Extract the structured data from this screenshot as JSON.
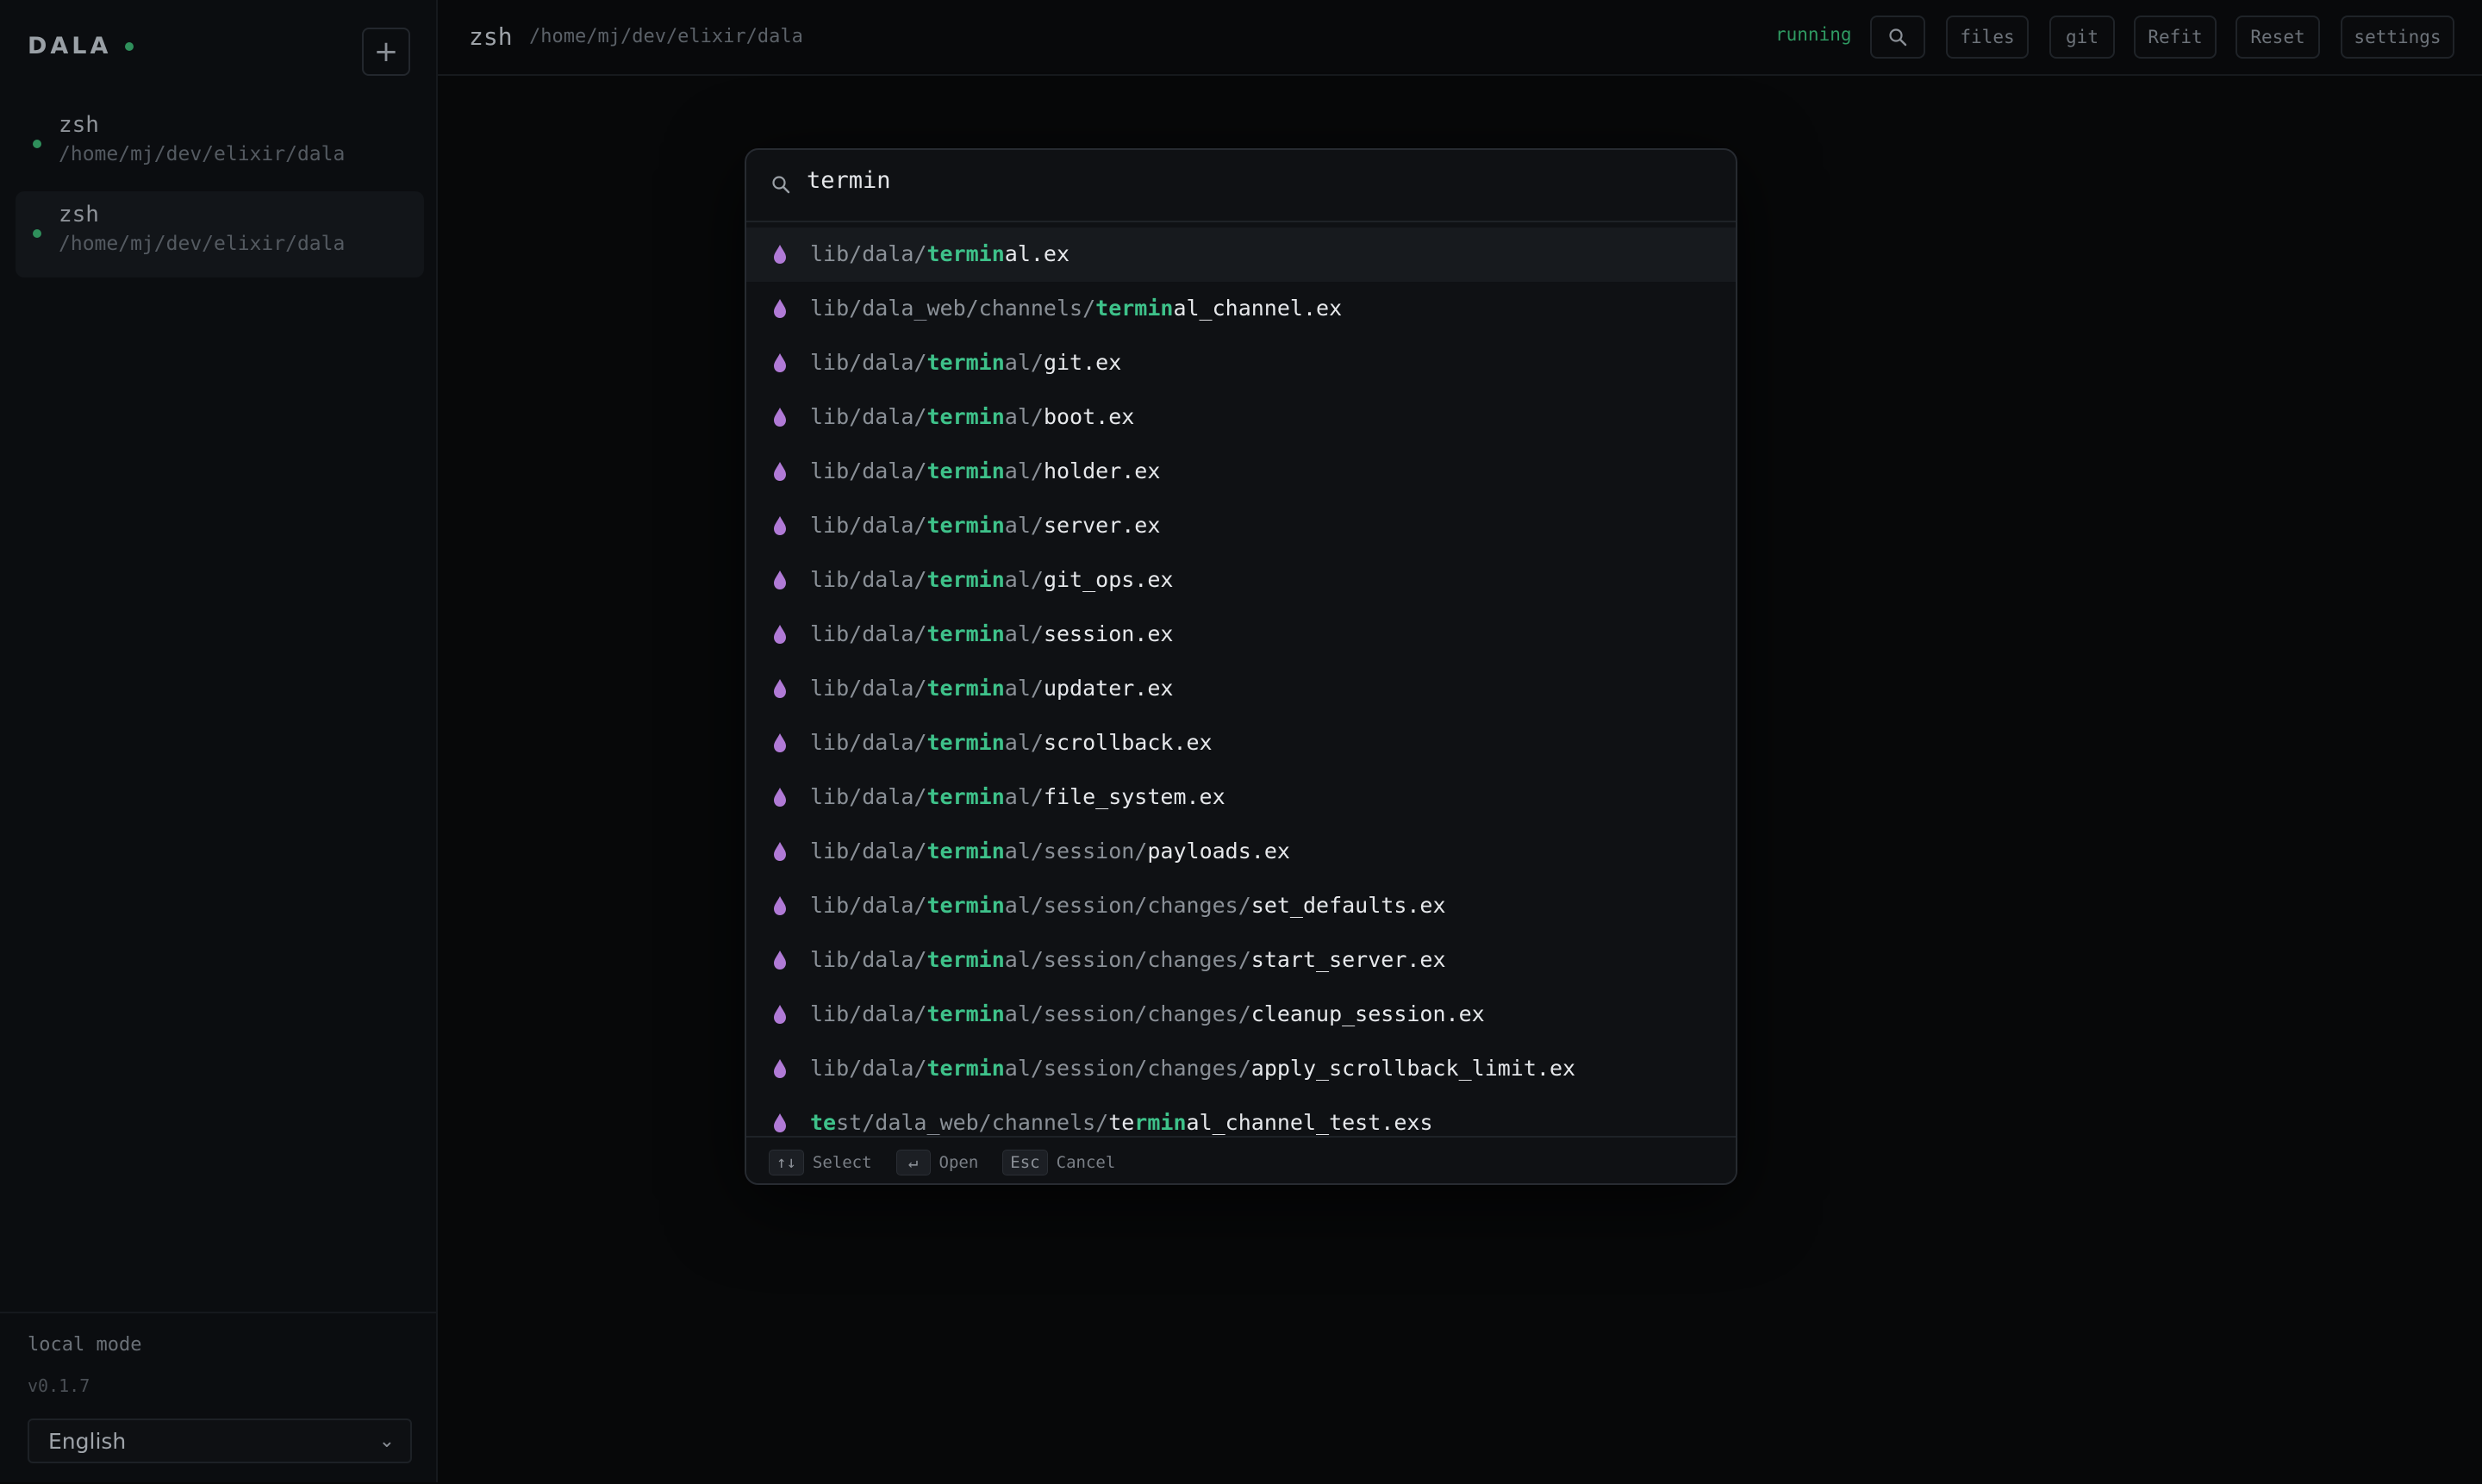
{
  "sidebar": {
    "brand": "DALA",
    "add_label": "+",
    "sessions": [
      {
        "name": "zsh",
        "path": "/home/mj/dev/elixir/dala"
      },
      {
        "name": "zsh",
        "path": "/home/mj/dev/elixir/dala"
      }
    ],
    "mode": "local mode",
    "version": "v0.1.7",
    "language": "English"
  },
  "topbar": {
    "title": "zsh",
    "path": "/home/mj/dev/elixir/dala",
    "status": "running",
    "buttons": {
      "files": "files",
      "git": "git",
      "refit": "Refit",
      "reset": "Reset",
      "settings": "settings"
    }
  },
  "palette": {
    "query": "termin",
    "results": [
      [
        [
          "dir",
          "lib/dala/"
        ],
        [
          "match",
          "termin"
        ],
        [
          "name",
          "al.ex"
        ]
      ],
      [
        [
          "dir",
          "lib/dala_web/channels/"
        ],
        [
          "match",
          "termin"
        ],
        [
          "name",
          "al_channel.ex"
        ]
      ],
      [
        [
          "dir",
          "lib/dala/"
        ],
        [
          "match",
          "termin"
        ],
        [
          "dir",
          "al/"
        ],
        [
          "name",
          "git.ex"
        ]
      ],
      [
        [
          "dir",
          "lib/dala/"
        ],
        [
          "match",
          "termin"
        ],
        [
          "dir",
          "al/"
        ],
        [
          "name",
          "boot.ex"
        ]
      ],
      [
        [
          "dir",
          "lib/dala/"
        ],
        [
          "match",
          "termin"
        ],
        [
          "dir",
          "al/"
        ],
        [
          "name",
          "holder.ex"
        ]
      ],
      [
        [
          "dir",
          "lib/dala/"
        ],
        [
          "match",
          "termin"
        ],
        [
          "dir",
          "al/"
        ],
        [
          "name",
          "server.ex"
        ]
      ],
      [
        [
          "dir",
          "lib/dala/"
        ],
        [
          "match",
          "termin"
        ],
        [
          "dir",
          "al/"
        ],
        [
          "name",
          "git_ops.ex"
        ]
      ],
      [
        [
          "dir",
          "lib/dala/"
        ],
        [
          "match",
          "termin"
        ],
        [
          "dir",
          "al/"
        ],
        [
          "name",
          "session.ex"
        ]
      ],
      [
        [
          "dir",
          "lib/dala/"
        ],
        [
          "match",
          "termin"
        ],
        [
          "dir",
          "al/"
        ],
        [
          "name",
          "updater.ex"
        ]
      ],
      [
        [
          "dir",
          "lib/dala/"
        ],
        [
          "match",
          "termin"
        ],
        [
          "dir",
          "al/"
        ],
        [
          "name",
          "scrollback.ex"
        ]
      ],
      [
        [
          "dir",
          "lib/dala/"
        ],
        [
          "match",
          "termin"
        ],
        [
          "dir",
          "al/"
        ],
        [
          "name",
          "file_system.ex"
        ]
      ],
      [
        [
          "dir",
          "lib/dala/"
        ],
        [
          "match",
          "termin"
        ],
        [
          "dir",
          "al/session/"
        ],
        [
          "name",
          "payloads.ex"
        ]
      ],
      [
        [
          "dir",
          "lib/dala/"
        ],
        [
          "match",
          "termin"
        ],
        [
          "dir",
          "al/session/changes/"
        ],
        [
          "name",
          "set_defaults.ex"
        ]
      ],
      [
        [
          "dir",
          "lib/dala/"
        ],
        [
          "match",
          "termin"
        ],
        [
          "dir",
          "al/session/changes/"
        ],
        [
          "name",
          "start_server.ex"
        ]
      ],
      [
        [
          "dir",
          "lib/dala/"
        ],
        [
          "match",
          "termin"
        ],
        [
          "dir",
          "al/session/changes/"
        ],
        [
          "name",
          "cleanup_session.ex"
        ]
      ],
      [
        [
          "dir",
          "lib/dala/"
        ],
        [
          "match",
          "termin"
        ],
        [
          "dir",
          "al/session/changes/"
        ],
        [
          "name",
          "apply_scrollback_limit.ex"
        ]
      ],
      [
        [
          "match",
          "te"
        ],
        [
          "dir",
          "st/dala_web/channels/"
        ],
        [
          "name",
          "te"
        ],
        [
          "match",
          "rmin"
        ],
        [
          "name",
          "al_channel_test.exs"
        ]
      ]
    ],
    "footer": {
      "select_keys": "↑↓",
      "select_label": "Select",
      "open_key": "↵",
      "open_label": "Open",
      "cancel_key": "Esc",
      "cancel_label": "Cancel"
    }
  },
  "colors": {
    "accent": "#3ec28a",
    "status_dot": "#2f8f5b",
    "file_icon": "#b07ad6"
  },
  "icons": {
    "search": "search-icon",
    "file": "elixir-drop-icon",
    "add": "plus-icon",
    "chevron": "chevron-down-icon"
  }
}
